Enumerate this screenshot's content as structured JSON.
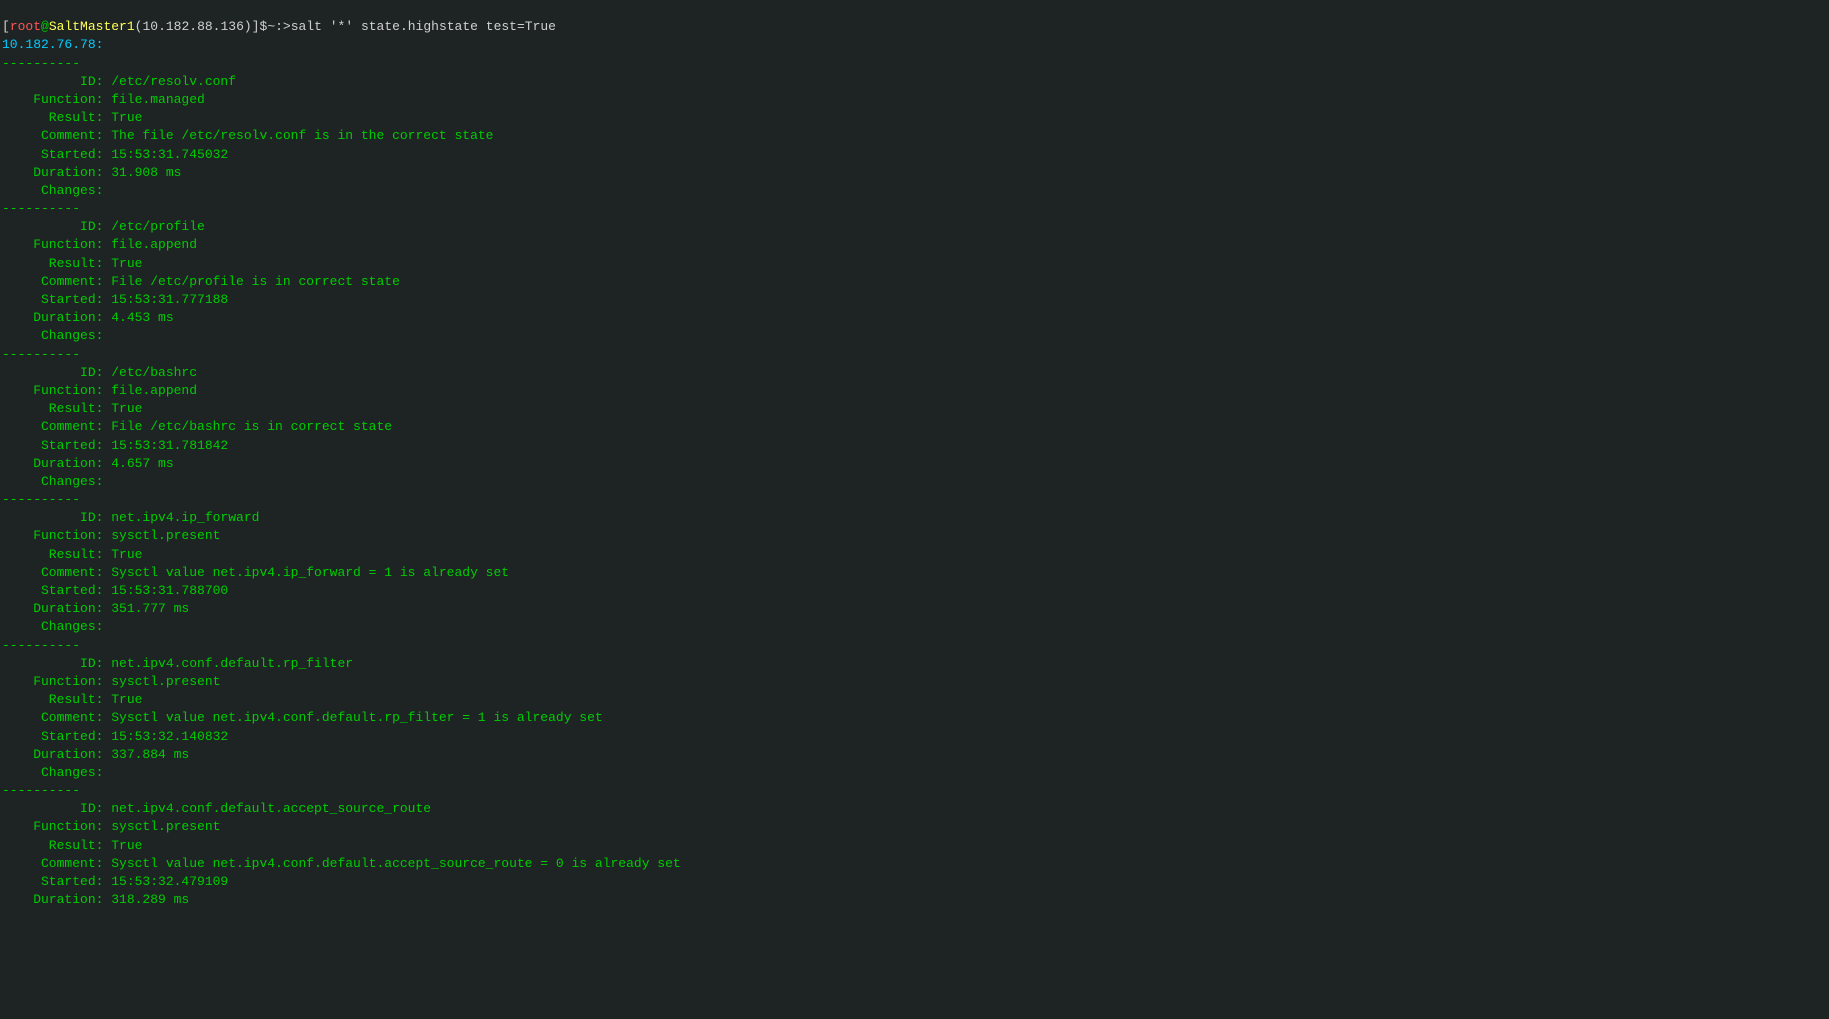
{
  "prompt": {
    "bracket_open": "[",
    "user": "root",
    "at": "@",
    "host": "SaltMaster1",
    "ip": "(10.182.88.136)",
    "bracket_close": "]",
    "tail": "$~:>",
    "command": "salt '*' state.highstate test=True"
  },
  "minion": "10.182.76.78:",
  "sep": "----------",
  "states": [
    {
      "lines": [
        "          ID: /etc/resolv.conf",
        "    Function: file.managed",
        "      Result: True",
        "     Comment: The file /etc/resolv.conf is in the correct state",
        "     Started: 15:53:31.745032",
        "    Duration: 31.908 ms",
        "     Changes:"
      ]
    },
    {
      "lines": [
        "          ID: /etc/profile",
        "    Function: file.append",
        "      Result: True",
        "     Comment: File /etc/profile is in correct state",
        "     Started: 15:53:31.777188",
        "    Duration: 4.453 ms",
        "     Changes:"
      ]
    },
    {
      "lines": [
        "          ID: /etc/bashrc",
        "    Function: file.append",
        "      Result: True",
        "     Comment: File /etc/bashrc is in correct state",
        "     Started: 15:53:31.781842",
        "    Duration: 4.657 ms",
        "     Changes:"
      ]
    },
    {
      "lines": [
        "          ID: net.ipv4.ip_forward",
        "    Function: sysctl.present",
        "      Result: True",
        "     Comment: Sysctl value net.ipv4.ip_forward = 1 is already set",
        "     Started: 15:53:31.788700",
        "    Duration: 351.777 ms",
        "     Changes:"
      ]
    },
    {
      "lines": [
        "          ID: net.ipv4.conf.default.rp_filter",
        "    Function: sysctl.present",
        "      Result: True",
        "     Comment: Sysctl value net.ipv4.conf.default.rp_filter = 1 is already set",
        "     Started: 15:53:32.140832",
        "    Duration: 337.884 ms",
        "     Changes:"
      ]
    },
    {
      "lines": [
        "          ID: net.ipv4.conf.default.accept_source_route",
        "    Function: sysctl.present",
        "      Result: True",
        "     Comment: Sysctl value net.ipv4.conf.default.accept_source_route = 0 is already set",
        "     Started: 15:53:32.479109",
        "    Duration: 318.289 ms"
      ]
    }
  ]
}
